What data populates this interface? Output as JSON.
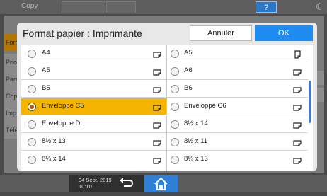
{
  "topbar": {
    "app_title": "Copy"
  },
  "help_label": "?",
  "background_tabs": [
    "Forr",
    "Prio",
    "Para",
    "Cop",
    "Imp",
    "Télé"
  ],
  "dialog": {
    "title": "Format papier : Imprimante",
    "cancel_label": "Annuler",
    "ok_label": "OK"
  },
  "options": [
    {
      "label": "A4",
      "selected": false,
      "orientation": "landscape"
    },
    {
      "label": "A5",
      "selected": false,
      "orientation": "portrait"
    },
    {
      "label": "A5",
      "selected": false,
      "orientation": "landscape"
    },
    {
      "label": "A6",
      "selected": false,
      "orientation": "landscape"
    },
    {
      "label": "B5",
      "selected": false,
      "orientation": "landscape"
    },
    {
      "label": "B6",
      "selected": false,
      "orientation": "landscape"
    },
    {
      "label": "Enveloppe C5",
      "selected": true,
      "orientation": "landscape"
    },
    {
      "label": "Enveloppe C6",
      "selected": false,
      "orientation": "landscape"
    },
    {
      "label": "Enveloppe DL",
      "selected": false,
      "orientation": "landscape"
    },
    {
      "label": "8½ x 14",
      "selected": false,
      "orientation": "landscape"
    },
    {
      "label": "8½ x 13",
      "selected": false,
      "orientation": "landscape"
    },
    {
      "label": "8½ x 11",
      "selected": false,
      "orientation": "landscape"
    },
    {
      "label": "8¼ x 14",
      "selected": false,
      "orientation": "landscape"
    },
    {
      "label": "8¼ x 13",
      "selected": false,
      "orientation": "landscape"
    }
  ],
  "footer": {
    "date": "04 Sept. 2019",
    "time": "10:10"
  },
  "colors": {
    "selected": "#f5b400",
    "accent": "#1e8cf0",
    "home": "#2f7fd6"
  }
}
